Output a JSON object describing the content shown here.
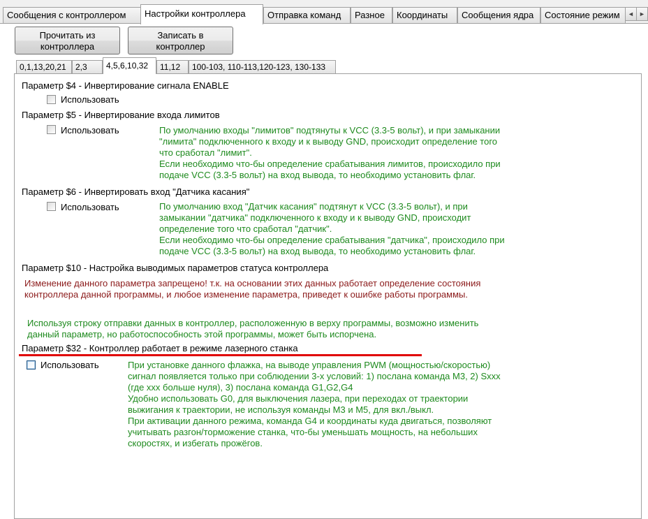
{
  "top_tabs": [
    {
      "label": "Сообщения с контроллером"
    },
    {
      "label": "Настройки контроллера"
    },
    {
      "label": "Отправка команд"
    },
    {
      "label": "Разное"
    },
    {
      "label": "Координаты"
    },
    {
      "label": "Сообщения ядра"
    },
    {
      "label": "Состояние режим"
    }
  ],
  "scroll": {
    "left": "◄",
    "right": "►"
  },
  "buttons": {
    "read": {
      "line1": "Прочитать из",
      "line2": "контроллера"
    },
    "write": {
      "line1": "Записать в",
      "line2": "контроллер"
    }
  },
  "sub_tabs": [
    {
      "label": "0,1,13,20,21"
    },
    {
      "label": "2,3"
    },
    {
      "label": "4,5,6,10,32"
    },
    {
      "label": "11,12"
    },
    {
      "label": "100-103, 110-113,120-123, 130-133"
    }
  ],
  "params": {
    "p4": {
      "title": "Параметр $4 - Инвертирование сигнала ENABLE",
      "use": "Использовать"
    },
    "p5": {
      "title": "Параметр $5 - Инвертирование входа лимитов",
      "use": "Использовать",
      "desc": [
        "По умолчанию входы \"лимитов\" подтянуты к VCC (3.3-5 вольт), и при замыкании",
        "\"лимита\" подключенного к входу и к выводу GND, происходит определение того",
        "что сработал \"лимит\".",
        "Если необходимо что-бы определение срабатывания лимитов, происходило при",
        "подаче VCC (3.3-5 вольт) на вход вывода, то необходимо установить флаг."
      ]
    },
    "p6": {
      "title": "Параметр $6 - Инвертировать вход \"Датчика касания\"",
      "use": "Использовать",
      "desc": [
        "По умолчанию вход \"Датчик касания\" подтянут к VCC (3.3-5 вольт), и при",
        "замыкании \"датчика\" подключенного к входу и к выводу GND, происходит",
        "определение того что сработал \"датчик\".",
        "Если необходимо что-бы определение срабатывания \"датчика\", происходило при",
        "подаче VCC (3.3-5 вольт) на вход вывода, то необходимо установить флаг."
      ]
    },
    "p10": {
      "title": "Параметр $10 - Настройка выводимых параметров статуса контроллера",
      "warning": [
        "Изменение данного параметра запрещено! т.к. на основании этих данных работает определение состояния",
        "контроллера данной программы, и любое изменение параметра, приведет к ошибке работы программы."
      ],
      "note": [
        "Используя строку отправки данных в контроллер, расположенную в верху программы, возможно изменить",
        "данный параметр, но работоспособность этой программы, может быть испорчена."
      ]
    },
    "p32": {
      "title": "Параметр $32 - Контроллер работает в режиме лазерного станка",
      "use": "Использовать",
      "desc": [
        "При установке данного флажка, на выводе управления PWM (мощностью/скоростью)",
        "сигнал появляется только при соблюдении 3-х условий: 1) послана команда M3, 2) Sxxx",
        "(где xxx больше нуля), 3) послана команда G1,G2,G4",
        "Удобно использовать G0, для выключения лазера, при переходах от траектории",
        "выжигания к траектории, не используя команды M3 и M5, для вкл./выкл.",
        "При активации данного режима, команда G4 и координаты куда двигаться, позволяют",
        "учитывать разгон/торможение станка, что-бы уменьшать мощность, на небольших",
        "скоростях, и избегать прожёгов."
      ]
    }
  },
  "colors": {
    "description": "#1e8a1e",
    "warning": "#8b1a1a",
    "highlight": "#e00000"
  }
}
